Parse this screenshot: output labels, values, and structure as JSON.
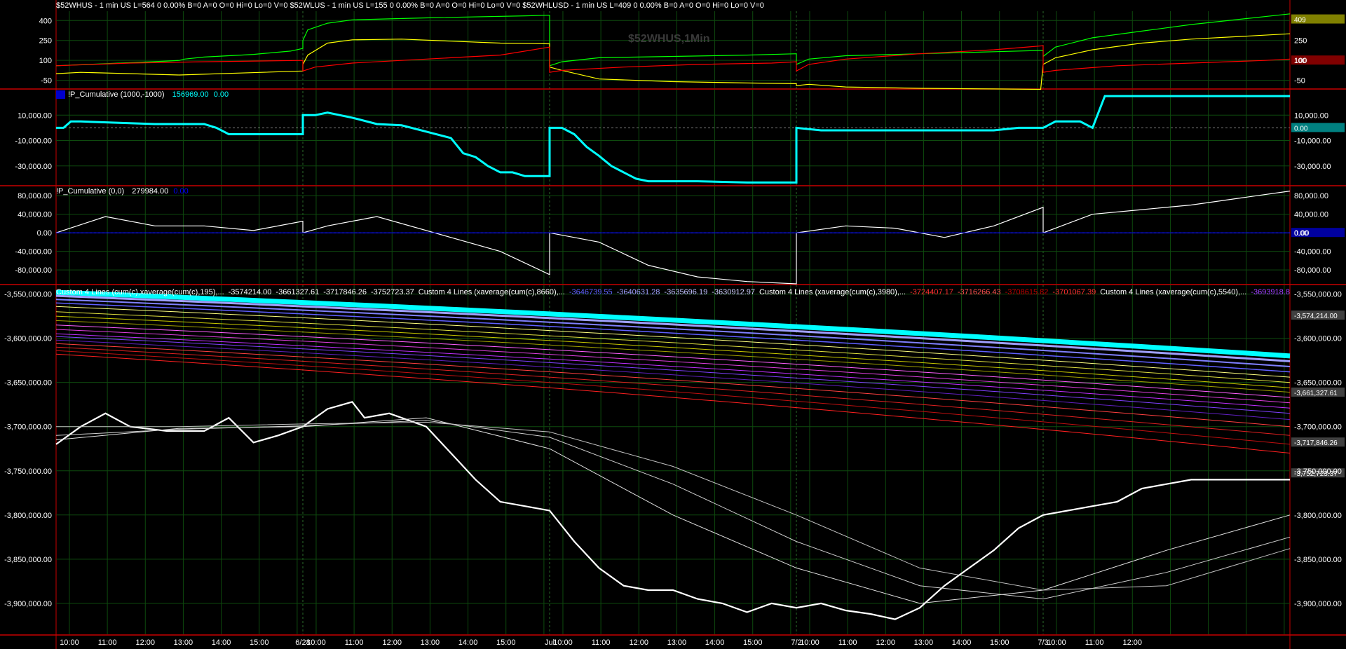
{
  "header": {
    "text": "$52WHUS - 1 min  US  L=564  0  0.00%  B=0  A=0  O=0  Hi=0  Lo=0  V=0  $52WLUS - 1 min  US  L=155  0  0.00%  B=0  A=0  O=0  Hi=0  Lo=0  V=0  $52WHLUSD - 1 min  US  L=409  0  0.00%  B=0  A=0  O=0  Hi=0  Lo=0  V=0"
  },
  "watermark": "$52WHUS,1Min",
  "panel2": {
    "label": "!P_Cumulative (1000,-1000)",
    "value1": "156969.00",
    "value2": "0.00"
  },
  "panel3": {
    "label": "!P_Cumulative (0,0)",
    "value1": "279984.00",
    "value2": "0.00"
  },
  "legend4": [
    {
      "text": "Custom 4 Lines (cum(c),xaverage(cum(c),195),...",
      "color": "#ffffff"
    },
    {
      "text": "-3574214.00",
      "color": "#ffffff"
    },
    {
      "text": "-3661327.61",
      "color": "#ffffff"
    },
    {
      "text": "-3717846.26",
      "color": "#ffffff"
    },
    {
      "text": "-3752723.37",
      "color": "#ffffff"
    },
    {
      "text": "Custom 4 Lines (xaverage(cum(c),8660),...",
      "color": "#ffffff"
    },
    {
      "text": "-3646739.55",
      "color": "#6060ff"
    },
    {
      "text": "-3640631.28",
      "color": "#a0a0ff"
    },
    {
      "text": "-3635696.19",
      "color": "#c0c0ff"
    },
    {
      "text": "-3630912.97",
      "color": "#d0d0ff"
    },
    {
      "text": "Custom 4 Lines (xaverage(cum(c),3980),...",
      "color": "#ffffff"
    },
    {
      "text": "-3724407.17",
      "color": "#ff3030"
    },
    {
      "text": "-3716266.43",
      "color": "#ff5050"
    },
    {
      "text": "-3708615.82",
      "color": "#c00000"
    },
    {
      "text": "-3701067.39",
      "color": "#ff3030"
    },
    {
      "text": "Custom 4 Lines (xaverage(cum(c),5540),...",
      "color": "#ffffff"
    },
    {
      "text": "-3693918.8...",
      "color": "#a040ff"
    }
  ],
  "colors": {
    "background": "#000000",
    "grid": "#0e4a0e",
    "separator": "#c80000",
    "green": "#00ff00",
    "red": "#ff0000",
    "yellow": "#ffff00",
    "cyan": "#00ffff",
    "white": "#ffffff",
    "blue": "#0000ff"
  },
  "chart_data": [
    {
      "type": "line",
      "panel": "52-week highs / lows",
      "yticks": [
        -50,
        100,
        250,
        400
      ],
      "ylim": [
        -110,
        470
      ],
      "grid": true,
      "series": [
        {
          "name": "$52WHUS",
          "color": "#00ff00",
          "x": [
            0,
            0.45,
            0.5,
            0.52,
            0.6,
            0.7,
            0.75,
            0.8,
            0.95,
            1.0,
            1.0,
            1.02,
            1.1,
            1.2,
            1.5,
            1.9,
            2.0,
            2.0,
            2.05,
            2.2,
            2.5,
            2.8,
            3.0,
            3.0,
            3.05,
            3.2,
            3.5,
            3.8,
            4.0,
            4.0,
            4.05,
            4.2,
            4.4,
            4.6,
            4.8,
            5.0
          ],
          "y": [
            60,
            95,
            100,
            110,
            125,
            135,
            140,
            145,
            170,
            190,
            250,
            330,
            380,
            405,
            420,
            435,
            440,
            60,
            90,
            120,
            130,
            140,
            150,
            70,
            110,
            135,
            150,
            165,
            175,
            130,
            200,
            270,
            320,
            370,
            410,
            450
          ]
        },
        {
          "name": "$52WHLUSD",
          "color": "#ffff00",
          "x": [
            0,
            0.1,
            0.5,
            1.0,
            1.0,
            1.02,
            1.1,
            1.2,
            1.4,
            1.6,
            1.8,
            2.0,
            2.0,
            2.05,
            2.2,
            2.5,
            2.8,
            3.0,
            3.0,
            3.05,
            3.2,
            3.5,
            3.8,
            3.99,
            4.0,
            4.05,
            4.2,
            4.4,
            4.6,
            4.8,
            5.0
          ],
          "y": [
            0,
            10,
            -10,
            20,
            70,
            140,
            230,
            255,
            260,
            245,
            230,
            225,
            50,
            25,
            -40,
            -60,
            -70,
            -75,
            -90,
            -80,
            -100,
            -110,
            -115,
            -118,
            70,
            120,
            180,
            230,
            260,
            280,
            300
          ]
        },
        {
          "name": "$52WLUS",
          "color": "#ff0000",
          "x": [
            0,
            0.3,
            0.6,
            1.0,
            1.0,
            1.05,
            1.2,
            1.4,
            1.6,
            1.8,
            2.0,
            2.0,
            2.05,
            2.3,
            2.6,
            2.9,
            3.0,
            3.0,
            3.05,
            3.2,
            3.5,
            3.8,
            4.0,
            4.0,
            4.05,
            4.3,
            4.6,
            4.9,
            5.0
          ],
          "y": [
            60,
            80,
            90,
            100,
            20,
            50,
            80,
            100,
            120,
            140,
            200,
            10,
            25,
            50,
            70,
            80,
            90,
            20,
            70,
            110,
            150,
            180,
            210,
            10,
            25,
            60,
            80,
            100,
            110
          ]
        }
      ],
      "last_value_badges": [
        {
          "text": "409",
          "color": "#808000",
          "y": 409
        },
        {
          "text": "100",
          "color": "#800000",
          "y": 100
        }
      ]
    },
    {
      "type": "line",
      "panel": "!P_Cumulative (1000,-1000)",
      "yticks": [
        10000,
        -10000,
        -30000
      ],
      "ylim": [
        -45000,
        30000
      ],
      "reference_line": 0,
      "grid": true,
      "series": [
        {
          "name": "!P_Cumulative (1000,-1000)",
          "color": "#00ffff",
          "x": [
            0,
            0.03,
            0.06,
            0.07,
            0.1,
            0.4,
            0.6,
            0.65,
            0.7,
            0.8,
            0.85,
            0.9,
            1.0,
            1.0,
            1.05,
            1.1,
            1.2,
            1.3,
            1.4,
            1.5,
            1.6,
            1.65,
            1.7,
            1.75,
            1.8,
            1.85,
            1.9,
            1.95,
            2.0,
            2.0,
            2.05,
            2.1,
            2.15,
            2.2,
            2.25,
            2.3,
            2.35,
            2.4,
            2.45,
            2.5,
            2.6,
            2.8,
            3.0,
            3.0,
            3.1,
            3.3,
            3.6,
            3.8,
            3.9,
            4.0,
            4.05,
            4.15,
            4.2,
            4.25,
            4.4,
            4.6,
            4.8,
            5.0
          ],
          "y": [
            0,
            0,
            5000,
            5000,
            5000,
            3000,
            3000,
            0,
            -5000,
            -5000,
            -5000,
            -5000,
            -5000,
            10000,
            10000,
            12000,
            8000,
            3000,
            2000,
            -3000,
            -8000,
            -20000,
            -23000,
            -30000,
            -35000,
            -35000,
            -38000,
            -38000,
            -38000,
            0,
            0,
            -5000,
            -15000,
            -22000,
            -30000,
            -35000,
            -40000,
            -42000,
            -42000,
            -42000,
            -42000,
            -43000,
            -43000,
            0,
            -2000,
            -2000,
            -2000,
            -2000,
            0,
            0,
            5000,
            5000,
            0,
            25000,
            25000,
            25000,
            25000,
            25000
          ]
        }
      ],
      "last_value_badges": [
        {
          "text": "0.00",
          "color": "#008080",
          "y": 0
        }
      ]
    },
    {
      "type": "line",
      "panel": "!P_Cumulative (0,0)",
      "yticks": [
        80000,
        40000,
        0,
        -40000,
        -80000
      ],
      "ylim": [
        -110000,
        100000
      ],
      "reference_line": 0,
      "grid": true,
      "series": [
        {
          "name": "!P_Cumulative (0,0)",
          "color": "#ffffff",
          "x": [
            0,
            0.2,
            0.4,
            0.6,
            0.8,
            1.0,
            1.0,
            1.1,
            1.3,
            1.6,
            1.8,
            2.0,
            2.0,
            2.2,
            2.4,
            2.6,
            2.8,
            3.0,
            3.0,
            3.2,
            3.4,
            3.6,
            3.8,
            4.0,
            4.0,
            4.2,
            4.4,
            4.6,
            4.8,
            5.0
          ],
          "y": [
            0,
            35000,
            15000,
            15000,
            5000,
            25000,
            0,
            15000,
            35000,
            -10000,
            -40000,
            -90000,
            0,
            -20000,
            -70000,
            -95000,
            -105000,
            -110000,
            0,
            15000,
            10000,
            -10000,
            15000,
            55000,
            0,
            40000,
            50000,
            60000,
            75000,
            90000
          ]
        },
        {
          "name": "zero",
          "color": "#0000ff",
          "x": [
            0,
            5
          ],
          "y": [
            0,
            0
          ]
        }
      ],
      "last_value_badges": [
        {
          "text": "0.00",
          "color": "#0000a0",
          "y": 0
        }
      ]
    },
    {
      "type": "line",
      "panel": "Custom 4 Lines",
      "yticks": [
        -3550000,
        -3600000,
        -3650000,
        -3700000,
        -3750000,
        -3800000,
        -3850000,
        -3900000
      ],
      "ylim": [
        -3935000,
        -3540000
      ],
      "grid": true,
      "band_lines": [
        {
          "color": "#00ffff",
          "start": -3548000,
          "end": -3620000,
          "width": 7
        },
        {
          "color": "#a0a0ff",
          "start": -3552000,
          "end": -3626000,
          "width": 3
        },
        {
          "color": "#8080ff",
          "start": -3556000,
          "end": -3632000,
          "width": 2
        },
        {
          "color": "#6060ff",
          "start": -3560000,
          "end": -3638000,
          "width": 1.5
        },
        {
          "color": "#ffff80",
          "start": -3564000,
          "end": -3644000,
          "width": 1
        },
        {
          "color": "#e0e040",
          "start": -3570000,
          "end": -3650000,
          "width": 1
        },
        {
          "color": "#c8c800",
          "start": -3575000,
          "end": -3656000,
          "width": 1
        },
        {
          "color": "#a0a000",
          "start": -3580000,
          "end": -3661000,
          "width": 1
        },
        {
          "color": "#ff60ff",
          "start": -3585000,
          "end": -3667000,
          "width": 1
        },
        {
          "color": "#e040e0",
          "start": -3590000,
          "end": -3673000,
          "width": 1
        },
        {
          "color": "#c030ff",
          "start": -3595000,
          "end": -3679000,
          "width": 1
        },
        {
          "color": "#8040ff",
          "start": -3598000,
          "end": -3685000,
          "width": 1
        },
        {
          "color": "#6020c0",
          "start": -3602000,
          "end": -3692000,
          "width": 1
        },
        {
          "color": "#ff4040",
          "start": -3606000,
          "end": -3700000,
          "width": 1
        },
        {
          "color": "#e02020",
          "start": -3610000,
          "end": -3710000,
          "width": 1
        },
        {
          "color": "#c01010",
          "start": -3614000,
          "end": -3720000,
          "width": 1
        },
        {
          "color": "#ff2020",
          "start": -3618000,
          "end": -3730000,
          "width": 1
        }
      ],
      "series": [
        {
          "name": "cum(c)",
          "color": "#ffffff",
          "width": 2.2,
          "x": [
            0,
            0.1,
            0.2,
            0.3,
            0.45,
            0.6,
            0.7,
            0.8,
            0.9,
            1.0,
            1.1,
            1.2,
            1.25,
            1.35,
            1.5,
            1.6,
            1.7,
            1.8,
            1.9,
            2.0,
            2.1,
            2.2,
            2.3,
            2.4,
            2.5,
            2.6,
            2.7,
            2.8,
            2.9,
            3.0,
            3.1,
            3.2,
            3.3,
            3.4,
            3.5,
            3.6,
            3.7,
            3.8,
            3.9,
            4.0,
            4.1,
            4.2,
            4.3,
            4.4,
            4.5,
            4.6,
            4.7,
            4.8,
            4.9,
            5.0
          ],
          "y": [
            -3720000,
            -3700000,
            -3685000,
            -3700000,
            -3705000,
            -3705000,
            -3690000,
            -3718000,
            -3710000,
            -3700000,
            -3680000,
            -3672000,
            -3690000,
            -3685000,
            -3700000,
            -3730000,
            -3760000,
            -3785000,
            -3790000,
            -3795000,
            -3830000,
            -3860000,
            -3880000,
            -3885000,
            -3885000,
            -3895000,
            -3900000,
            -3910000,
            -3900000,
            -3905000,
            -3900000,
            -3908000,
            -3912000,
            -3918000,
            -3905000,
            -3880000,
            -3860000,
            -3840000,
            -3815000,
            -3800000,
            -3795000,
            -3790000,
            -3785000,
            -3770000,
            -3765000,
            -3760000,
            -3760000,
            -3760000,
            -3760000,
            -3760000
          ]
        },
        {
          "name": "avg 1",
          "color": "#e0e0e0",
          "width": 1,
          "x": [
            0,
            0.5,
            1.0,
            1.5,
            2.0,
            2.5,
            3.0,
            3.5,
            4.0,
            4.5,
            5.0
          ],
          "y": [
            -3715000,
            -3702000,
            -3700000,
            -3690000,
            -3725000,
            -3800000,
            -3860000,
            -3900000,
            -3885000,
            -3840000,
            -3800000
          ]
        },
        {
          "name": "avg 2",
          "color": "#d0d0d0",
          "width": 1,
          "x": [
            0,
            0.5,
            1.0,
            1.5,
            2.0,
            2.5,
            3.0,
            3.5,
            4.0,
            4.5,
            5.0
          ],
          "y": [
            -3710000,
            -3703000,
            -3699000,
            -3693000,
            -3712000,
            -3765000,
            -3830000,
            -3880000,
            -3895000,
            -3865000,
            -3825000
          ]
        },
        {
          "name": "avg 3",
          "color": "#c0c0c0",
          "width": 1,
          "x": [
            0,
            0.5,
            1.0,
            1.5,
            2.0,
            2.5,
            3.0,
            3.5,
            4.0,
            4.5,
            5.0
          ],
          "y": [
            -3700000,
            -3700000,
            -3697000,
            -3695000,
            -3706000,
            -3745000,
            -3800000,
            -3860000,
            -3885000,
            -3880000,
            -3838000
          ]
        }
      ],
      "last_value_badges": [
        {
          "text": "-3,574,214.00",
          "color": "#404040",
          "y": -3574214
        },
        {
          "text": "-3,661,327.61",
          "color": "#404040",
          "y": -3661328
        },
        {
          "text": "-3,717,846.26",
          "color": "#404040",
          "y": -3717846
        },
        {
          "text": "-3,752,723.37",
          "color": "#404040",
          "y": -3752723
        }
      ]
    }
  ],
  "yaxis_labels": {
    "p1_left": [
      "400",
      "250",
      "100",
      "-50"
    ],
    "p1_right": [
      "250",
      "100",
      "-50"
    ],
    "p2": [
      "10,000.00",
      "-10,000.00",
      "-30,000.00"
    ],
    "p3": [
      "80,000.00",
      "40,000.00",
      "0.00",
      "-40,000.00",
      "-80,000.00"
    ],
    "p4": [
      "-3,550,000.00",
      "-3,600,000.00",
      "-3,650,000.00",
      "-3,700,000.00",
      "-3,750,000.00",
      "-3,800,000.00",
      "-3,850,000.00",
      "-3,900,000.00"
    ]
  },
  "xaxis": [
    "10:00",
    "11:00",
    "12:00",
    "13:00",
    "14:00",
    "15:00",
    "6/28",
    "10:00",
    "11:00",
    "12:00",
    "13:00",
    "14:00",
    "15:00",
    "Jul",
    "10:00",
    "11:00",
    "12:00",
    "13:00",
    "14:00",
    "15:00",
    "7/2",
    "10:00",
    "11:00",
    "12:00",
    "13:00",
    "14:00",
    "15:00",
    "7/3",
    "10:00",
    "11:00",
    "12:00"
  ]
}
